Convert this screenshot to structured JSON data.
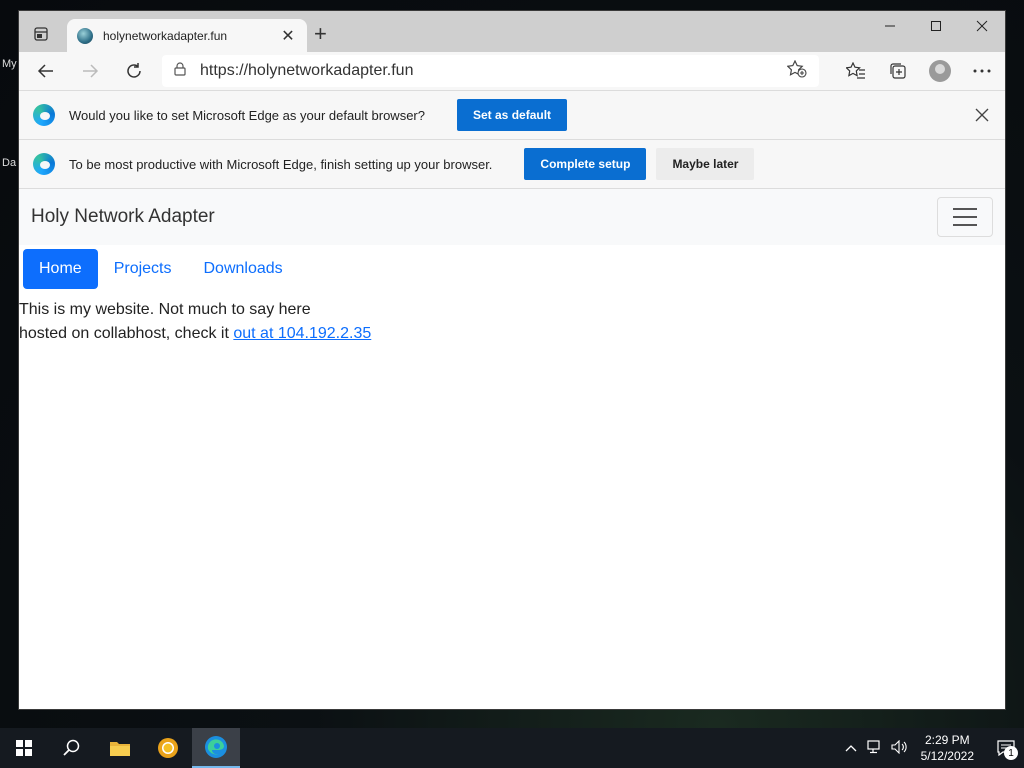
{
  "desktop": {
    "edge_labels": [
      "My",
      "Da"
    ]
  },
  "browser": {
    "tab": {
      "title": "holynetworkadapter.fun"
    },
    "address": {
      "url": "https://holynetworkadapter.fun"
    },
    "infobars": [
      {
        "message": "Would you like to set Microsoft Edge as your default browser?",
        "primary_label": "Set as default"
      },
      {
        "message": "To be most productive with Microsoft Edge, finish setting up your browser.",
        "primary_label": "Complete setup",
        "secondary_label": "Maybe later"
      }
    ]
  },
  "page": {
    "brand": "Holy Network Adapter",
    "nav": [
      {
        "label": "Home",
        "active": true
      },
      {
        "label": "Projects",
        "active": false
      },
      {
        "label": "Downloads",
        "active": false
      }
    ],
    "line1": "This is my website. Not much to say here",
    "line2_prefix": "hosted on collabhost, check it ",
    "line2_link": "out at 104.192.2.35"
  },
  "taskbar": {
    "time": "2:29 PM",
    "date": "5/12/2022",
    "notification_count": "1"
  },
  "colors": {
    "accent": "#0d6efd",
    "edge_button": "#0a6ed1",
    "taskbar": "#151a20"
  }
}
